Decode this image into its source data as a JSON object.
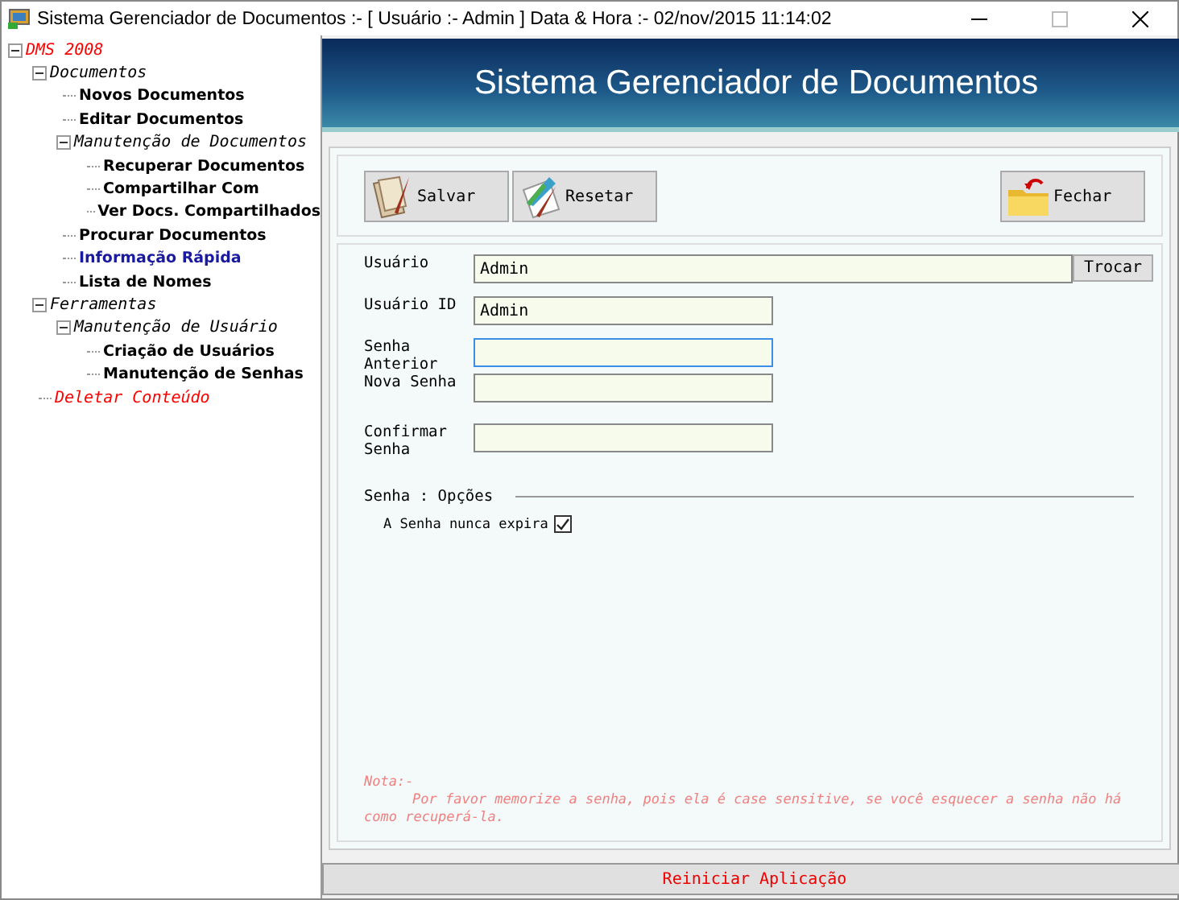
{
  "window": {
    "title": "Sistema Gerenciador de Documentos :- [ Usuário :- Admin ]  Data & Hora :- 02/nov/2015 11:14:02"
  },
  "tree": [
    {
      "label": "DMS 2008",
      "kind": "group",
      "color": "#ff0000",
      "expanded": true,
      "children": [
        {
          "label": "Documentos",
          "kind": "group",
          "color": "#000000",
          "expanded": true,
          "children": [
            {
              "label": "Novos Documentos",
              "kind": "leaf",
              "color": "#000000"
            },
            {
              "label": "Editar Documentos",
              "kind": "leaf",
              "color": "#000000"
            },
            {
              "label": "Manutenção de Documentos",
              "kind": "group",
              "color": "#000000",
              "expanded": true,
              "children": [
                {
                  "label": "Recuperar Documentos",
                  "kind": "leaf",
                  "color": "#000000"
                },
                {
                  "label": "Compartilhar Com",
                  "kind": "leaf",
                  "color": "#000000"
                },
                {
                  "label": "Ver Docs. Compartilhados",
                  "kind": "leaf",
                  "color": "#000000"
                }
              ]
            },
            {
              "label": "Procurar Documentos",
              "kind": "leaf",
              "color": "#000000"
            },
            {
              "label": "Informação Rápida",
              "kind": "leaf",
              "color": "#1a1aa0"
            },
            {
              "label": "Lista de Nomes",
              "kind": "leaf",
              "color": "#000000"
            }
          ]
        },
        {
          "label": "Ferramentas",
          "kind": "group",
          "color": "#000000",
          "expanded": true,
          "children": [
            {
              "label": "Manutenção de Usuário",
              "kind": "group",
              "color": "#000000",
              "expanded": true,
              "children": [
                {
                  "label": "Criação de Usuários",
                  "kind": "leaf",
                  "color": "#000000"
                },
                {
                  "label": "Manutenção de Senhas",
                  "kind": "leaf",
                  "color": "#000000"
                }
              ]
            }
          ]
        },
        {
          "label": "Deletar Conteúdo",
          "kind": "group",
          "color": "#ff0000"
        }
      ]
    }
  ],
  "header": {
    "title": "Sistema Gerenciador de Documentos"
  },
  "toolbar": [
    {
      "label": "Salvar",
      "kind": "save"
    },
    {
      "label": "Resetar",
      "kind": "reset"
    },
    {
      "label": "Fechar",
      "kind": "close"
    }
  ],
  "form": {
    "fields": [
      {
        "label": "Usuário",
        "value": "Admin",
        "kind": "wide",
        "focused": false,
        "button": "Trocar"
      },
      {
        "label": "Usuário ID",
        "value": "Admin",
        "kind": "normal",
        "focused": false
      },
      {
        "label": "Senha Anterior",
        "kind": "normal",
        "focused": true
      },
      {
        "label": "Nova Senha",
        "kind": "normal",
        "focused": false
      },
      {
        "label": "Confirmar Senha",
        "kind": "normal",
        "focused": false
      }
    ],
    "options_title": "Senha : Opções",
    "options": [
      {
        "label": "A Senha nunca expira",
        "checked": true
      }
    ]
  },
  "note": {
    "title": "Nota:-",
    "text": "Por favor memorize a senha, pois ela é case sensitive, se você esquecer a senha não há como recuperá-la."
  },
  "footer_button": "Reiniciar Aplicação"
}
